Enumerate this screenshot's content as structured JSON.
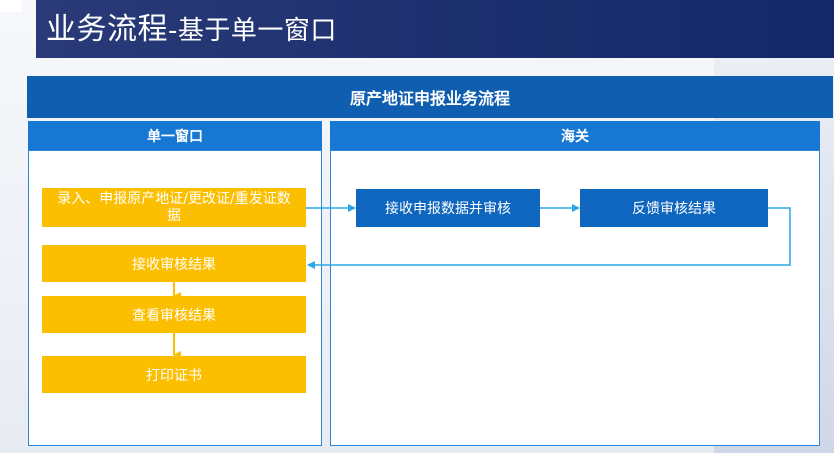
{
  "page": {
    "title_main": "业务流程",
    "title_sub": "-基于单一窗口"
  },
  "diagram": {
    "title": "原产地证申报业务流程",
    "lanes": [
      {
        "label": "单一窗口"
      },
      {
        "label": "海关"
      }
    ],
    "steps": {
      "submit": "录入、申报原产地证/更改证/重发证数据",
      "receive_result": "接收审核结果",
      "view_result": "查看审核结果",
      "print_cert": "打印证书",
      "customs_review": "接收申报数据并审核",
      "customs_feedback": "反馈审核结果"
    }
  },
  "colors": {
    "title_bar": "#1c2f6e",
    "header": "#0f5eb0",
    "lane_header": "#1778d4",
    "applicant_step": "#fcbf00",
    "customs_step": "#0f66bf",
    "connector": "#29a9e8"
  }
}
